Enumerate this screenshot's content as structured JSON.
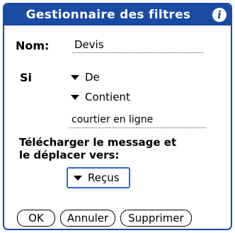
{
  "dialog": {
    "title": "Gestionnaire des filtres",
    "info_icon": "info-icon",
    "accent_color": "#1b4aa5"
  },
  "name": {
    "label": "Nom:",
    "value": "Devis"
  },
  "condition": {
    "label": "Si",
    "field": "De",
    "operator": "Contient",
    "value": "courtier en ligne"
  },
  "action": {
    "instruction_line1": "Télécharger le message et",
    "instruction_line2": "le déplacer vers:",
    "folder": "Reçus"
  },
  "buttons": {
    "ok": "OK",
    "cancel": "Annuler",
    "delete": "Supprimer"
  }
}
